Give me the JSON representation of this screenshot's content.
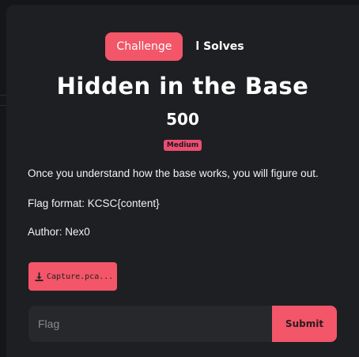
{
  "tabs": {
    "challenge_label": "Challenge",
    "solves_label": "l Solves"
  },
  "challenge": {
    "title": "Hidden in the Base",
    "points": "500",
    "difficulty": "Medium",
    "description": "Once you understand how the base works, you will figure out.",
    "flag_format": "Flag format: KCSC{content}",
    "author": "Author: Nex0"
  },
  "file": {
    "label": "Capture.pca...",
    "icon": "download-icon"
  },
  "flag_form": {
    "placeholder": "Flag",
    "submit_label": "Submit"
  },
  "colors": {
    "accent": "#f25668",
    "badge": "#ec4e72",
    "background": "#1e1f22"
  }
}
